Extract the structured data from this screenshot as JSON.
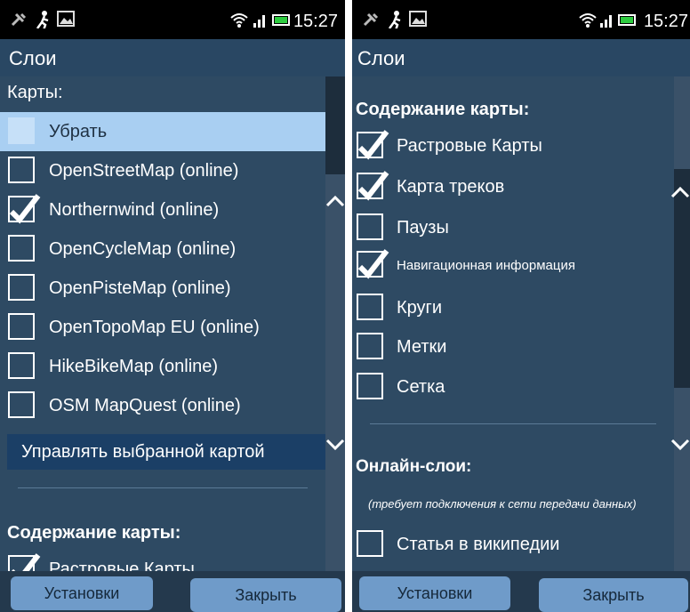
{
  "left": {
    "time": "15:27",
    "title": "Слои",
    "maps_header": "Карты:",
    "maps": [
      {
        "label": "Убрать",
        "checked": false,
        "selected": true
      },
      {
        "label": "OpenStreetMap (online)",
        "checked": false
      },
      {
        "label": "Northernwind (online)",
        "checked": true
      },
      {
        "label": "OpenCycleMap (online)",
        "checked": false
      },
      {
        "label": "OpenPisteMap (online)",
        "checked": false
      },
      {
        "label": "OpenTopoMap EU (online)",
        "checked": false
      },
      {
        "label": "HikeBikeMap (online)",
        "checked": false
      },
      {
        "label": "OSM MapQuest (online)",
        "checked": false
      }
    ],
    "manage_button": "Управлять выбранной картой",
    "content_header": "Содержание карты:",
    "partial_item": "Растровые Карты",
    "buttons": {
      "settings": "Установки",
      "close": "Закрыть"
    }
  },
  "right": {
    "time": "15:27",
    "title": "Слои",
    "content_header": "Содержание карты:",
    "content_items": [
      {
        "label": "Растровые Карты",
        "checked": true
      },
      {
        "label": "Карта треков",
        "checked": true
      },
      {
        "label": "Паузы",
        "checked": false
      },
      {
        "label": "Навигационная информация",
        "checked": true
      },
      {
        "label": "Круги",
        "checked": false
      },
      {
        "label": "Метки",
        "checked": false
      },
      {
        "label": "Сетка",
        "checked": false
      }
    ],
    "online_header": "Онлайн-слои:",
    "online_note": "(требует подключения к сети передачи данных)",
    "online_items": [
      {
        "label": "Статья в википедии",
        "checked": false
      }
    ],
    "buttons": {
      "settings": "Установки",
      "close": "Закрыть"
    }
  },
  "colors": {
    "background": "#2e4a63",
    "selected": "#a9cff2",
    "button": "#6f9bc9",
    "statusbar": "#000000"
  }
}
